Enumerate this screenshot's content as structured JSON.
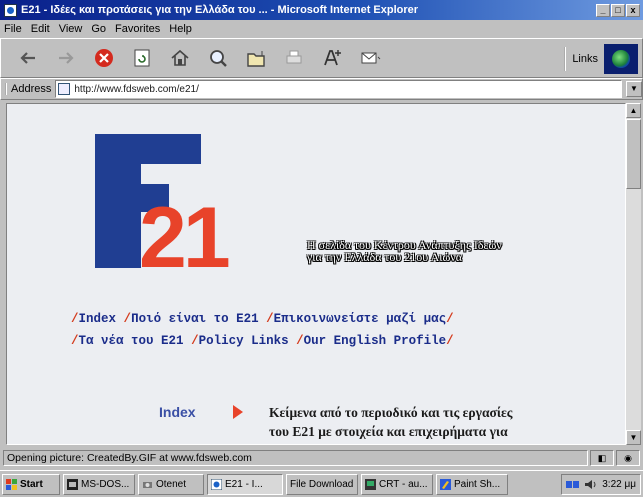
{
  "window": {
    "title": "E21 - Ιδέες και προτάσεις για την Ελλάδα του ... - Microsoft Internet Explorer",
    "controls": {
      "minimize": "_",
      "maximize": "□",
      "close": "x"
    }
  },
  "menu": {
    "items": [
      "File",
      "Edit",
      "View",
      "Go",
      "Favorites",
      "Help"
    ]
  },
  "toolbar": {
    "buttons": [
      "back-icon",
      "forward-icon",
      "stop-icon",
      "refresh-icon",
      "home-icon",
      "search-icon",
      "favorites-icon",
      "print-icon",
      "font-icon",
      "mail-icon"
    ],
    "links_label": "Links"
  },
  "address": {
    "label": "Address",
    "url": "http://www.fdsweb.com/e21/"
  },
  "page": {
    "logo": {
      "letter": "E",
      "number": "21",
      "blue": "#203e92",
      "red": "#e8432a"
    },
    "tagline_line1": "Η σελίδα του Κέντρου Ανάπτυξης Ιδεών",
    "tagline_line2": "για την Ελλάδα του 21ου Αιώνα",
    "nav": {
      "index": "Index",
      "about": "Ποιό είναι το E21",
      "contact": "Επικοινωνείστε μαζί μας",
      "news": "Τα νέα του E21",
      "policy": "Policy Links",
      "english": "Our English Profile"
    },
    "slash": "/",
    "index_label": "Index",
    "index_desc_line1": "Κείμενα από το περιοδικό και τις εργασίες",
    "index_desc_line2": "του E21 με στοιχεία και επιχειρήματα για"
  },
  "status": {
    "text": "Opening picture: CreatedBy.GIF at www.fdsweb.com"
  },
  "taskbar": {
    "start": "Start",
    "tasks": [
      "MS-DOS...",
      "Otenet",
      "E21 - I...",
      "File Download",
      "CRT - au...",
      "Paint Sh..."
    ],
    "clock": "3:22 μμ"
  },
  "colors": {
    "title_start": "#0a1f8a",
    "title_end": "#6f9be0",
    "nav_text": "#1a2c8a",
    "nav_slash": "#d43c1e",
    "page_bg": "#eceef2"
  }
}
